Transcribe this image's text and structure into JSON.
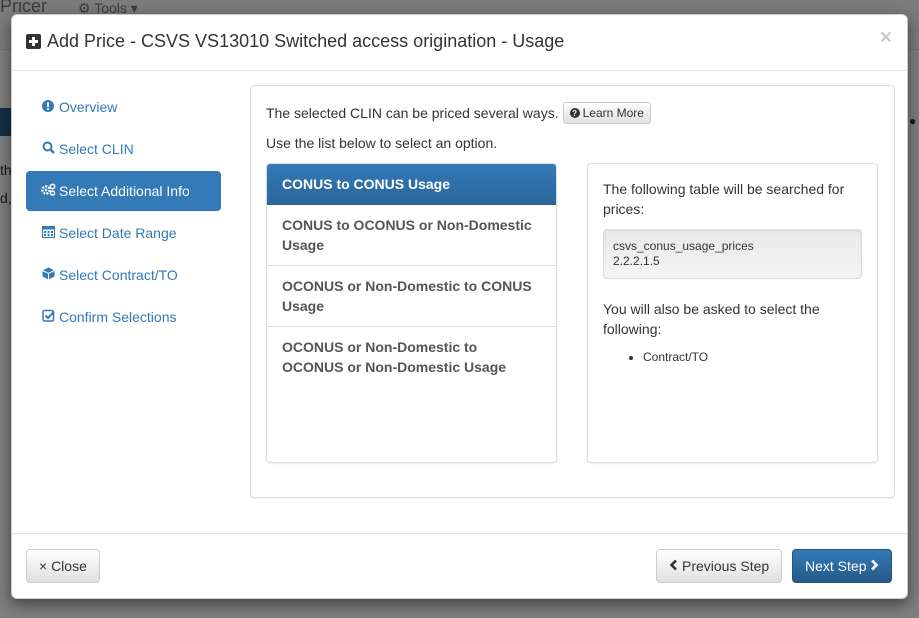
{
  "background": {
    "brand": "Pricer",
    "tools_menu": "Tools ▾",
    "snippet1": "the",
    "snippet2": "d,"
  },
  "modal": {
    "title": "Add Price - CSVS VS13010 Switched access origination - Usage",
    "close_glyph": "×"
  },
  "sidebar": {
    "items": [
      {
        "label": "Overview",
        "icon": "exclamation-circle-icon",
        "glyph": "❶",
        "active": false
      },
      {
        "label": "Select CLIN",
        "icon": "search-icon",
        "glyph": "🔍",
        "active": false
      },
      {
        "label": "Select Additional Info",
        "icon": "gears-icon",
        "glyph": "⚙",
        "active": true
      },
      {
        "label": "Select Date Range",
        "icon": "calendar-icon",
        "glyph": "▦",
        "active": false
      },
      {
        "label": "Select Contract/TO",
        "icon": "cube-icon",
        "glyph": "⬢",
        "active": false
      },
      {
        "label": "Confirm Selections",
        "icon": "check-square-icon",
        "glyph": "☑",
        "active": false
      }
    ]
  },
  "content": {
    "intro": "The selected CLIN can be priced several ways.",
    "learn_more": "Learn More",
    "instruction": "Use the list below to select an option.",
    "options": [
      {
        "label": "CONUS to CONUS Usage",
        "active": true
      },
      {
        "label": "CONUS to OCONUS or Non-Domestic Usage",
        "active": false
      },
      {
        "label": "OCONUS or Non-Domestic to CONUS Usage",
        "active": false
      },
      {
        "label": "OCONUS or Non-Domestic to OCONUS or Non-Domestic Usage",
        "active": false
      }
    ],
    "info": {
      "table_text": "The following table will be searched for prices:",
      "table_name": "csvs_conus_usage_prices",
      "table_version": "2.2.2.1.5",
      "also_text": "You will also be asked to select the following:",
      "also_items": [
        "Contract/TO"
      ]
    }
  },
  "footer": {
    "close_label": "× Close",
    "prev_label": "Previous Step",
    "next_label": "Next Step"
  },
  "colors": {
    "primary": "#337ab7",
    "primary_dark": "#265a88"
  }
}
